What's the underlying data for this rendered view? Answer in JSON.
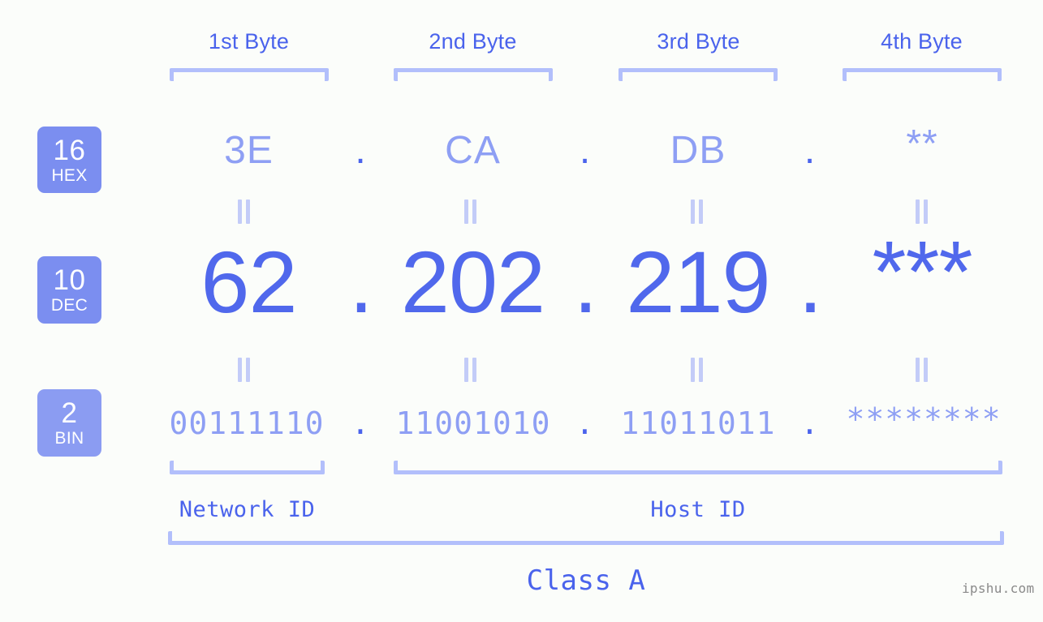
{
  "background_color": "#fbfdfa",
  "accent_color": "#4a63ec",
  "muted_accent_color": "#8e9ff4",
  "bracket_color": "#b2bffb",
  "badge_color": "#7b8ef0",
  "byte_headers": [
    {
      "label": "1st Byte"
    },
    {
      "label": "2nd Byte"
    },
    {
      "label": "3rd Byte"
    },
    {
      "label": "4th Byte"
    }
  ],
  "rows": [
    {
      "radix": "16",
      "radix_abbr": "HEX",
      "values": [
        "3E",
        "CA",
        "DB",
        "**"
      ],
      "separator": "."
    },
    {
      "radix": "10",
      "radix_abbr": "DEC",
      "values": [
        "62",
        "202",
        "219",
        "***"
      ],
      "separator": "."
    },
    {
      "radix": "2",
      "radix_abbr": "BIN",
      "values": [
        "00111110",
        "11001010",
        "11011011",
        "********"
      ],
      "separator": "."
    }
  ],
  "segments": {
    "network_id_label": "Network ID",
    "host_id_label": "Host ID",
    "class_label": "Class A"
  },
  "watermark": "ipshu.com"
}
